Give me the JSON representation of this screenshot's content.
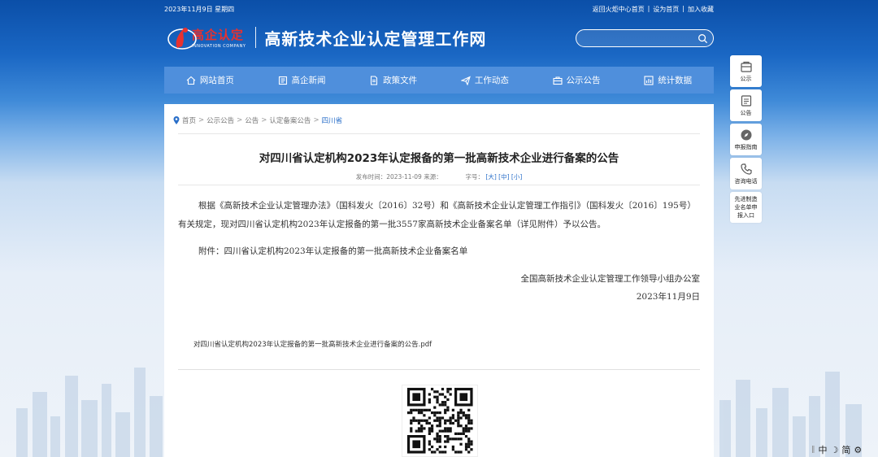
{
  "top_bar": {
    "date": "2023年11月9日 星期四",
    "links": [
      "返回火炬中心首页",
      "设为首页",
      "加入收藏"
    ]
  },
  "logo": {
    "name_cn": "高企认定",
    "name_en": "INNOVATION COMPANY"
  },
  "site_title": "高新技术企业认定管理工作网",
  "search": {
    "placeholder": ""
  },
  "nav": [
    {
      "label": "网站首页",
      "icon": "home-icon"
    },
    {
      "label": "高企新闻",
      "icon": "news-icon"
    },
    {
      "label": "政策文件",
      "icon": "document-icon"
    },
    {
      "label": "工作动态",
      "icon": "send-icon"
    },
    {
      "label": "公示公告",
      "icon": "briefcase-icon"
    },
    {
      "label": "统计数据",
      "icon": "chart-icon"
    }
  ],
  "breadcrumb": [
    "首页",
    "公示公告",
    "公告",
    "认定备案公告",
    "四川省"
  ],
  "article": {
    "title": "对四川省认定机构2023年认定报备的第一批高新技术企业进行备案的公告",
    "meta_prefix": "发布时间：2023-11-09 来源：",
    "meta_size_label": "字号：",
    "size_options": [
      "[大]",
      "[中]",
      "[小]"
    ],
    "paragraph1": "根据《高新技术企业认定管理办法》（国科发火〔2016〕32号）和《高新技术企业认定管理工作指引》（国科发火〔2016〕195号）有关规定，现对四川省认定机构2023年认定报备的第一批3557家高新技术企业备案名单（详见附件）予以公告。",
    "paragraph2": "附件：四川省认定机构2023年认定报备的第一批高新技术企业备案名单",
    "sign_org": "全国高新技术企业认定管理工作领导小组办公室",
    "sign_date": "2023年11月9日",
    "attachment": "对四川省认定机构2023年认定报备的第一批高新技术企业进行备案的公告.pdf"
  },
  "side_menu": [
    {
      "label": "公示",
      "icon": "publicity-icon"
    },
    {
      "label": "公告",
      "icon": "notice-icon"
    },
    {
      "label": "申报指南",
      "icon": "compass-icon"
    },
    {
      "label": "咨询电话",
      "icon": "phone-icon"
    },
    {
      "label": "先进制造业名单申报入口",
      "icon": ""
    }
  ],
  "side_menu_multiline": [
    "先进制造",
    "业名单申",
    "报入口"
  ],
  "lang_switch": [
    "中",
    "简"
  ],
  "colors": {
    "nav_bg": "#4f8fdc",
    "accent": "#2a6fc9",
    "logo_red": "#e8312f"
  }
}
